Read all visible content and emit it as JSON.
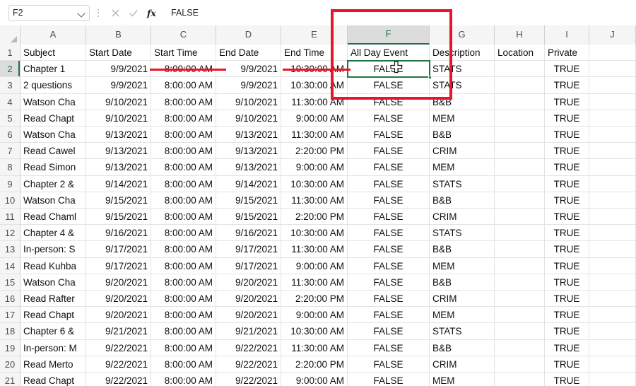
{
  "formula_bar": {
    "name_box_value": "F2",
    "name_box_dropdown_icon": "chevron-down-icon",
    "kebab_icon": "more-options-icon",
    "cancel_icon": "cancel-x-icon",
    "confirm_icon": "confirm-check-icon",
    "function_icon": "fx-insert-function-icon",
    "formula_value": "FALSE",
    "formula_placeholder": ""
  },
  "grid": {
    "column_headers": [
      "A",
      "B",
      "C",
      "D",
      "E",
      "F",
      "G",
      "H",
      "I",
      "J"
    ],
    "selected_column": "F",
    "selected_row": "2",
    "active_cell": "F2",
    "row_numbers": [
      "1",
      "2",
      "3",
      "4",
      "5",
      "6",
      "7",
      "8",
      "9",
      "10",
      "11",
      "12",
      "13",
      "14",
      "15",
      "16",
      "17",
      "18",
      "19",
      "20",
      "21"
    ],
    "headers": {
      "A": "Subject",
      "B": "Start Date",
      "C": "Start Time",
      "D": "End Date",
      "E": "End Time",
      "F": "All Day Event",
      "G": "Description",
      "H": "Location",
      "I": "Private",
      "J": ""
    },
    "rows": [
      {
        "n": "2",
        "A": "Chapter 1",
        "B": "9/9/2021",
        "C": "8:00:00 AM",
        "D": "9/9/2021",
        "E": "10:30:00 AM",
        "F": "FALSE",
        "G": "STATS",
        "H": "",
        "I": "TRUE",
        "J": ""
      },
      {
        "n": "3",
        "A": "2 questions",
        "B": "9/9/2021",
        "C": "8:00:00 AM",
        "D": "9/9/2021",
        "E": "10:30:00 AM",
        "F": "FALSE",
        "G": "STATS",
        "H": "",
        "I": "TRUE",
        "J": ""
      },
      {
        "n": "4",
        "A": "Watson Cha",
        "B": "9/10/2021",
        "C": "8:00:00 AM",
        "D": "9/10/2021",
        "E": "11:30:00 AM",
        "F": "FALSE",
        "G": "B&B",
        "H": "",
        "I": "TRUE",
        "J": ""
      },
      {
        "n": "5",
        "A": "Read Chapt",
        "B": "9/10/2021",
        "C": "8:00:00 AM",
        "D": "9/10/2021",
        "E": "9:00:00 AM",
        "F": "FALSE",
        "G": "MEM",
        "H": "",
        "I": "TRUE",
        "J": ""
      },
      {
        "n": "6",
        "A": "Watson Cha",
        "B": "9/13/2021",
        "C": "8:00:00 AM",
        "D": "9/13/2021",
        "E": "11:30:00 AM",
        "F": "FALSE",
        "G": "B&B",
        "H": "",
        "I": "TRUE",
        "J": ""
      },
      {
        "n": "7",
        "A": "Read Cawel",
        "B": "9/13/2021",
        "C": "8:00:00 AM",
        "D": "9/13/2021",
        "E": "2:20:00 PM",
        "F": "FALSE",
        "G": "CRIM",
        "H": "",
        "I": "TRUE",
        "J": ""
      },
      {
        "n": "8",
        "A": "Read Simon",
        "B": "9/13/2021",
        "C": "8:00:00 AM",
        "D": "9/13/2021",
        "E": "9:00:00 AM",
        "F": "FALSE",
        "G": "MEM",
        "H": "",
        "I": "TRUE",
        "J": ""
      },
      {
        "n": "9",
        "A": "Chapter 2 &",
        "B": "9/14/2021",
        "C": "8:00:00 AM",
        "D": "9/14/2021",
        "E": "10:30:00 AM",
        "F": "FALSE",
        "G": "STATS",
        "H": "",
        "I": "TRUE",
        "J": ""
      },
      {
        "n": "10",
        "A": "Watson Cha",
        "B": "9/15/2021",
        "C": "8:00:00 AM",
        "D": "9/15/2021",
        "E": "11:30:00 AM",
        "F": "FALSE",
        "G": "B&B",
        "H": "",
        "I": "TRUE",
        "J": ""
      },
      {
        "n": "11",
        "A": "Read Chaml",
        "B": "9/15/2021",
        "C": "8:00:00 AM",
        "D": "9/15/2021",
        "E": "2:20:00 PM",
        "F": "FALSE",
        "G": "CRIM",
        "H": "",
        "I": "TRUE",
        "J": ""
      },
      {
        "n": "12",
        "A": "Chapter 4 &",
        "B": "9/16/2021",
        "C": "8:00:00 AM",
        "D": "9/16/2021",
        "E": "10:30:00 AM",
        "F": "FALSE",
        "G": "STATS",
        "H": "",
        "I": "TRUE",
        "J": ""
      },
      {
        "n": "13",
        "A": "In-person: S",
        "B": "9/17/2021",
        "C": "8:00:00 AM",
        "D": "9/17/2021",
        "E": "11:30:00 AM",
        "F": "FALSE",
        "G": "B&B",
        "H": "",
        "I": "TRUE",
        "J": ""
      },
      {
        "n": "14",
        "A": "Read Kuhba",
        "B": "9/17/2021",
        "C": "8:00:00 AM",
        "D": "9/17/2021",
        "E": "9:00:00 AM",
        "F": "FALSE",
        "G": "MEM",
        "H": "",
        "I": "TRUE",
        "J": ""
      },
      {
        "n": "15",
        "A": "Watson Cha",
        "B": "9/20/2021",
        "C": "8:00:00 AM",
        "D": "9/20/2021",
        "E": "11:30:00 AM",
        "F": "FALSE",
        "G": "B&B",
        "H": "",
        "I": "TRUE",
        "J": ""
      },
      {
        "n": "16",
        "A": "Read Rafter",
        "B": "9/20/2021",
        "C": "8:00:00 AM",
        "D": "9/20/2021",
        "E": "2:20:00 PM",
        "F": "FALSE",
        "G": "CRIM",
        "H": "",
        "I": "TRUE",
        "J": ""
      },
      {
        "n": "17",
        "A": "Read Chapt",
        "B": "9/20/2021",
        "C": "8:00:00 AM",
        "D": "9/20/2021",
        "E": "9:00:00 AM",
        "F": "FALSE",
        "G": "MEM",
        "H": "",
        "I": "TRUE",
        "J": ""
      },
      {
        "n": "18",
        "A": "Chapter 6 &",
        "B": "9/21/2021",
        "C": "8:00:00 AM",
        "D": "9/21/2021",
        "E": "10:30:00 AM",
        "F": "FALSE",
        "G": "STATS",
        "H": "",
        "I": "TRUE",
        "J": ""
      },
      {
        "n": "19",
        "A": "In-person: M",
        "B": "9/22/2021",
        "C": "8:00:00 AM",
        "D": "9/22/2021",
        "E": "11:30:00 AM",
        "F": "FALSE",
        "G": "B&B",
        "H": "",
        "I": "TRUE",
        "J": ""
      },
      {
        "n": "20",
        "A": "Read Merto",
        "B": "9/22/2021",
        "C": "8:00:00 AM",
        "D": "9/22/2021",
        "E": "2:20:00 PM",
        "F": "FALSE",
        "G": "CRIM",
        "H": "",
        "I": "TRUE",
        "J": ""
      },
      {
        "n": "21",
        "A": "Read Chapt",
        "B": "9/22/2021",
        "C": "8:00:00 AM",
        "D": "9/22/2021",
        "E": "9:00:00 AM",
        "F": "FALSE",
        "G": "MEM",
        "H": "",
        "I": "TRUE",
        "J": ""
      }
    ]
  },
  "annotations": {
    "highlight_box_label": "column-f-highlight-box",
    "strike_1_label": "strikethrough-start-time-row2",
    "strike_2_label": "strikethrough-end-time-row2",
    "color": "#e8152a"
  },
  "cursor": {
    "icon": "mouse-pointer-cell-cursor"
  },
  "colors": {
    "accent_green": "#217346",
    "header_gray": "#f5f5f5",
    "gridline": "#e3e3e3",
    "annotation_red": "#e8152a"
  }
}
